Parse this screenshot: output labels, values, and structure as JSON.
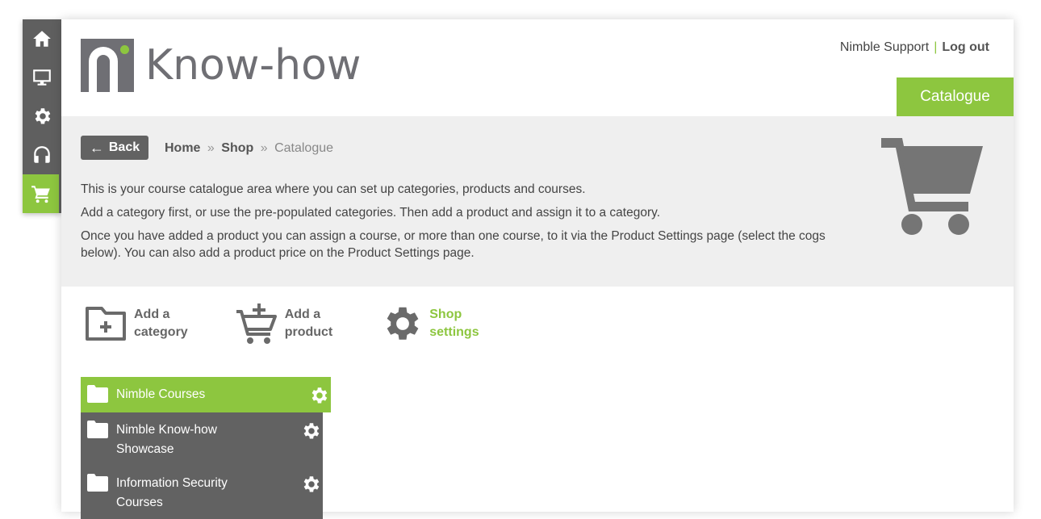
{
  "nav": {
    "items": [
      {
        "icon": "home-icon"
      },
      {
        "icon": "monitor-icon"
      },
      {
        "icon": "gear-icon"
      },
      {
        "icon": "headset-icon"
      },
      {
        "icon": "cart-icon",
        "active": true
      }
    ]
  },
  "brand": {
    "logo_text": "Know-how",
    "accent": "#8dc63f",
    "dark": "#626262"
  },
  "top_links": {
    "support": "Nimble Support",
    "separator": "|",
    "logout": "Log out"
  },
  "tab": {
    "label": "Catalogue"
  },
  "back": {
    "label": "Back"
  },
  "breadcrumb": {
    "home": "Home",
    "shop": "Shop",
    "current": "Catalogue",
    "sep": "»"
  },
  "description": {
    "p1": "This is your course catalogue area where you can set up categories, products and courses.",
    "p2": "Add a category first, or use the pre-populated categories. Then add a product and assign it to a category.",
    "p3": "Once you have added a product you can assign a course, or more than one course, to it via the Product Settings page (select the cogs below). You can also add a product price on the Product Settings page."
  },
  "actions": {
    "add_category": {
      "line1": "Add a",
      "line2": "category"
    },
    "add_product": {
      "line1": "Add a",
      "line2": "product"
    },
    "shop_settings": {
      "line1": "Shop",
      "line2": "settings"
    }
  },
  "categories": [
    {
      "name": "Nimble Courses"
    },
    {
      "name": "Nimble Know-how Showcase"
    },
    {
      "name": "Information Security Courses"
    }
  ]
}
